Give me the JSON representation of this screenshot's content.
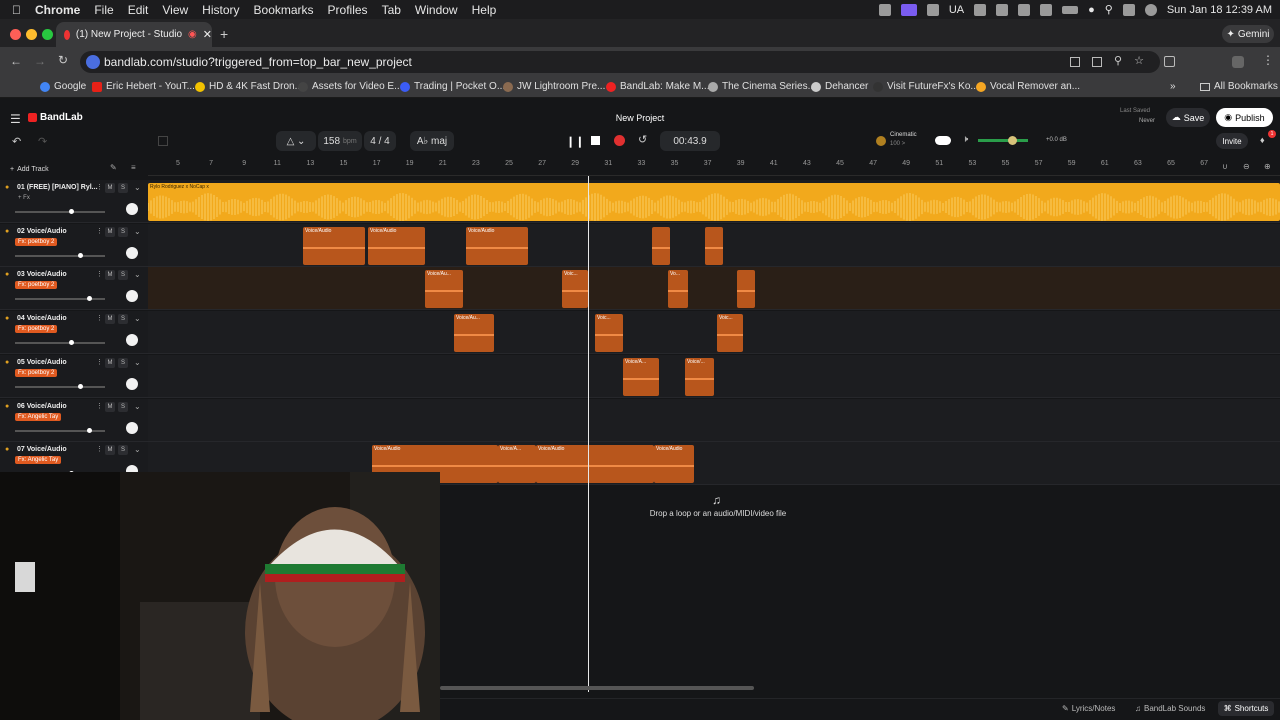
{
  "menubar": {
    "app": "Chrome",
    "items": [
      "File",
      "Edit",
      "View",
      "History",
      "Bookmarks",
      "Profiles",
      "Tab",
      "Window",
      "Help"
    ],
    "lang": "UA",
    "clock": "Sun Jan 18  12:39 AM"
  },
  "browser": {
    "tab_title": "(1) New Project - Studio",
    "url": "bandlab.com/studio?triggered_from=top_bar_new_project",
    "gemini": "Gemini",
    "all_bookmarks": "All Bookmarks",
    "bookmarks": [
      "Google",
      "Eric Hebert - YouT...",
      "HD & 4K Fast Dron...",
      "Assets for Video E...",
      "Trading | Pocket O...",
      "JW Lightroom Pre...",
      "BandLab: Make M...",
      "The Cinema Series...",
      "Dehancer",
      "Visit FutureFx's Ko...",
      "Vocal Remover an..."
    ]
  },
  "studio": {
    "brand": "BandLab",
    "project_title": "New Project",
    "last_saved_label": "Last Saved",
    "last_saved_value": "Never",
    "save": "Save",
    "publish": "Publish",
    "invite": "Invite",
    "notif_count": "1",
    "bpm": "158",
    "bpm_unit": "bpm",
    "time_sig": "4 / 4",
    "key": "A♭ maj",
    "time": "00:43.9",
    "preset_name": "Cinematic",
    "preset_sub": "100 >",
    "volume_db": "+0.0 dB",
    "add_track": "Add Track",
    "drop_hint": "Drop a loop or an audio/MIDI/video file",
    "ruler": [
      "5",
      "7",
      "9",
      "11",
      "13",
      "15",
      "17",
      "19",
      "21",
      "23",
      "25",
      "27",
      "29",
      "31",
      "33",
      "35",
      "37",
      "39",
      "41",
      "43",
      "45",
      "47",
      "49",
      "51",
      "53",
      "55",
      "57",
      "59",
      "61",
      "63",
      "65",
      "67"
    ],
    "tracks": [
      {
        "name": "01  (FREE) [PIANO] Ryl...",
        "fx": "+ Fx",
        "clip_label": "Rylo Rodriguez x NoCap x"
      },
      {
        "name": "02  Voice/Audio",
        "fx": "Fx: poetboy 2"
      },
      {
        "name": "03  Voice/Audio",
        "fx": "Fx: poetboy 2"
      },
      {
        "name": "04  Voice/Audio",
        "fx": "Fx: poetboy 2"
      },
      {
        "name": "05  Voice/Audio",
        "fx": "Fx: poetboy 2"
      },
      {
        "name": "06  Voice/Audio",
        "fx": "Fx: Angelic Tay"
      },
      {
        "name": "07  Voice/Audio",
        "fx": "Fx: Angelic Tay"
      }
    ],
    "clip_labels": {
      "voice_audio": "Voice/Audio",
      "voice_au": "Voice/Au...",
      "voice_short": "Voic...",
      "vo": "Vo...",
      "voice_a": "Voice/A...",
      "voice_slash": "Voice/..."
    },
    "bottom": {
      "lyrics": "Lyrics/Notes",
      "sounds": "BandLab Sounds",
      "shortcuts": "Shortcuts"
    },
    "accent": "#f2a91c",
    "clip_color": "#b8561c"
  }
}
